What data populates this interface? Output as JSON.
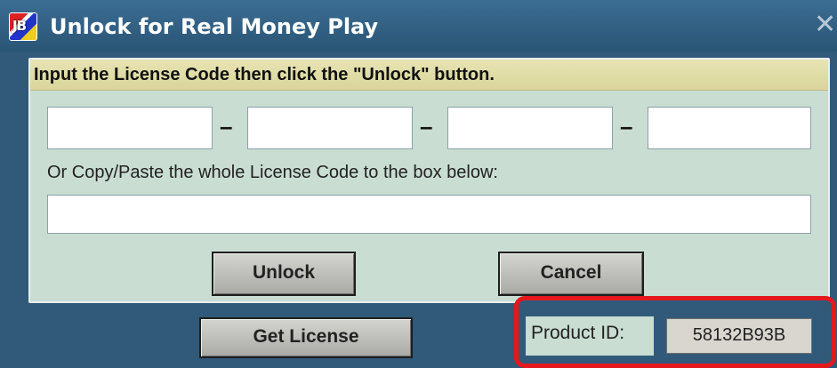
{
  "window": {
    "title": "Unlock for Real Money Play",
    "icon_name": "app-logo-icon",
    "icon_text": "JB",
    "close_glyph": "✕",
    "frame_color": "#315a7a"
  },
  "panel": {
    "instruction": "Input the License Code then click the \"Unlock\" button.",
    "code_fields": [
      {
        "value": "",
        "placeholder": ""
      },
      {
        "value": "",
        "placeholder": ""
      },
      {
        "value": "",
        "placeholder": ""
      },
      {
        "value": "",
        "placeholder": ""
      }
    ],
    "separator": "–",
    "paste_label": "Or Copy/Paste the whole License Code to the box below:",
    "paste_field": {
      "value": "",
      "placeholder": ""
    },
    "unlock_label": "Unlock",
    "cancel_label": "Cancel"
  },
  "footer": {
    "get_license_label": "Get License",
    "product_id_label": "Product ID:",
    "product_id_value": "58132B93B",
    "highlight_color": "#e3191d"
  }
}
